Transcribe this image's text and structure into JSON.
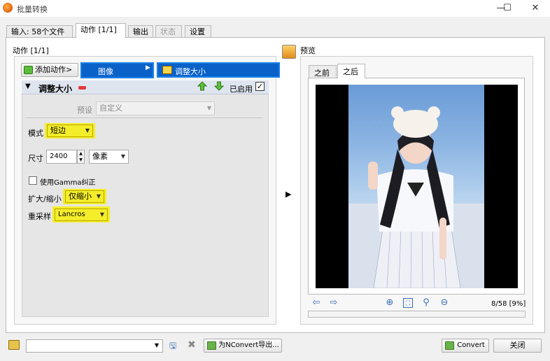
{
  "window": {
    "title": "批量转换",
    "min_glyph": "—",
    "max_glyph": "☐",
    "close_glyph": "✕"
  },
  "tabs": [
    {
      "label": "输入:  58个文件",
      "active": false,
      "enabled": true
    },
    {
      "label": "动作 [1/1]",
      "active": true,
      "enabled": true
    },
    {
      "label": "输出",
      "active": false,
      "enabled": true
    },
    {
      "label": "状态",
      "active": false,
      "enabled": false
    },
    {
      "label": "设置",
      "active": false,
      "enabled": true
    }
  ],
  "actions": {
    "group_label": "动作 [1/1]",
    "add_button_label": "添加动作>",
    "menu": {
      "category": "图像",
      "category_arrow": "▶",
      "submenu_item": "调整大小"
    },
    "panel": {
      "collapse_glyph": "▼",
      "title": "调整大小",
      "enabled_label": "已启用",
      "enabled_checked": "✓",
      "preset_label": "预设",
      "preset_value": "自定义",
      "mode_label": "模式",
      "mode_value": "短边",
      "size_label": "尺寸",
      "size_value": "2400",
      "unit_value": "像素",
      "gamma_label": "使用Gamma纠正",
      "scale_label": "扩大/缩小",
      "scale_value": "仅缩小",
      "resample_label": "重采样",
      "resample_value": "Lancros",
      "dropdown_glyph": "▼",
      "spin_up": "▲",
      "spin_down": "▼"
    },
    "play_glyph": "▶"
  },
  "preview": {
    "group_label": "预览",
    "tabs": [
      "之前",
      "之后"
    ],
    "active_tab": "之后",
    "page_info": "8/58 [9%]"
  },
  "bottom": {
    "export_button_label": "为NConvert导出...",
    "convert_button_label": "Convert",
    "close_button_label": "关闭"
  },
  "colors": {
    "highlight": "#f4ed2a",
    "menu_blue": "#0a62c9"
  }
}
